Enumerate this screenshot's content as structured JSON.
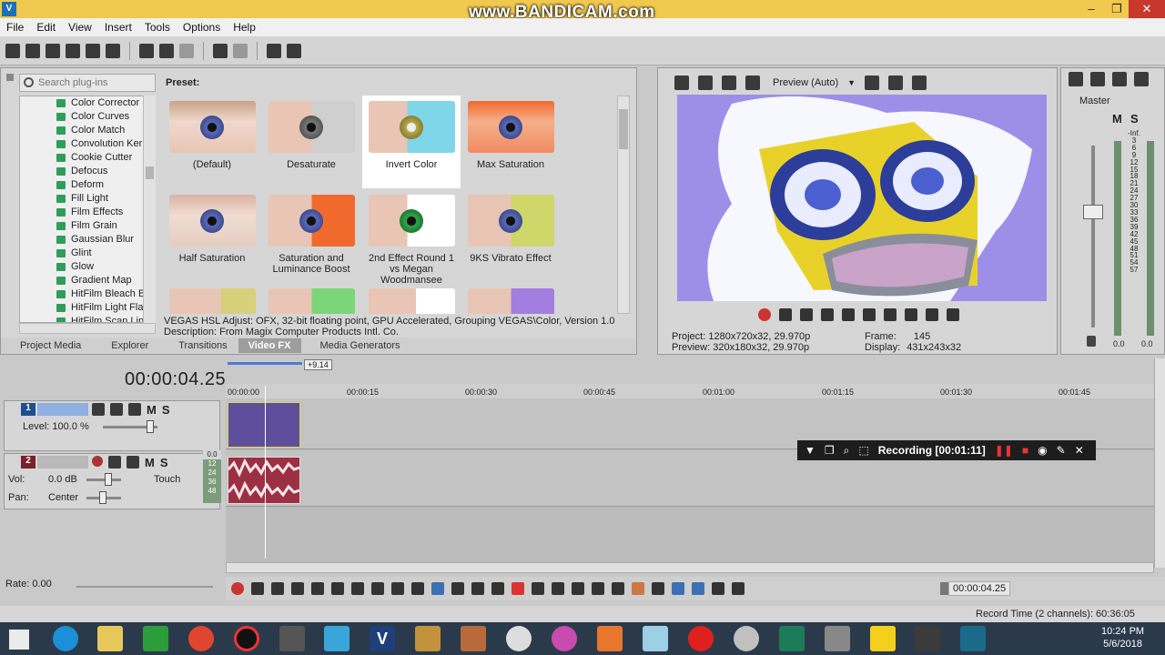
{
  "titlebar": {
    "watermark": "www.BANDICAM.com",
    "minimize": "–",
    "maximize": "❐",
    "close": "✕"
  },
  "menu": [
    "File",
    "Edit",
    "View",
    "Insert",
    "Tools",
    "Options",
    "Help"
  ],
  "plugins": {
    "search_placeholder": "Search plug-ins",
    "items": [
      "Color Corrector (S",
      "Color Curves",
      "Color Match",
      "Convolution Kern",
      "Cookie Cutter",
      "Defocus",
      "Deform",
      "Fill Light",
      "Film Effects",
      "Film Grain",
      "Gaussian Blur",
      "Glint",
      "Glow",
      "Gradient Map",
      "HitFilm Bleach Byp",
      "HitFilm Light Flare",
      "HitFilm Scan Lines"
    ],
    "preset_label": "Preset:",
    "presets": [
      {
        "name": "(Default)"
      },
      {
        "name": "Desaturate"
      },
      {
        "name": "Invert Color"
      },
      {
        "name": "Max Saturation"
      },
      {
        "name": "Half Saturation"
      },
      {
        "name": "Saturation and Luminance Boost"
      },
      {
        "name": "2nd Effect Round 1 vs Megan Woodmansee"
      },
      {
        "name": "9KS Vibrato Effect"
      }
    ],
    "desc_line1": "VEGAS HSL Adjust: OFX, 32-bit floating point, GPU Accelerated, Grouping VEGAS\\Color, Version 1.0",
    "desc_line2": "Description: From Magix Computer Products Intl. Co."
  },
  "dock_tabs": [
    "Project Media",
    "Explorer",
    "Transitions",
    "Video FX",
    "Media Generators"
  ],
  "preview": {
    "mode": "Preview (Auto)",
    "project_label": "Project:",
    "project_value": "1280x720x32, 29.970p",
    "preview_label": "Preview:",
    "preview_value": "320x180x32, 29.970p",
    "frame_label": "Frame:",
    "frame_value": "145",
    "display_label": "Display:",
    "display_value": "431x243x32"
  },
  "master": {
    "title": "Master",
    "m": "M",
    "s": "S",
    "scale": [
      "-Inf.",
      "-Inf.",
      "3",
      "6",
      "9",
      "12",
      "15",
      "18",
      "21",
      "24",
      "27",
      "30",
      "33",
      "36",
      "39",
      "42",
      "45",
      "48",
      "51",
      "54",
      "57"
    ],
    "left_level": "0.0",
    "right_level": "0.0"
  },
  "timeline": {
    "time": "00:00:04.25",
    "cursor_offset": "+9.14",
    "ticks": [
      "00:00:00",
      "00:00:15",
      "00:00:30",
      "00:00:45",
      "00:01:00",
      "00:01:15",
      "00:01:30",
      "00:01:45"
    ],
    "track1": {
      "num": "1",
      "level": "Level: 100.0 %",
      "m": "M",
      "s": "S"
    },
    "track2": {
      "num": "2",
      "vol_label": "Vol:",
      "vol_value": "0.0 dB",
      "pan_label": "Pan:",
      "pan_value": "Center",
      "touch": "Touch",
      "m": "M",
      "s": "S",
      "meter": [
        "0.0",
        "12",
        "24",
        "36",
        "48"
      ]
    },
    "rate": "Rate: 0.00",
    "transport_time": "00:00:04.25",
    "record_time": "Record Time (2 channels): 60:36:05"
  },
  "recording": {
    "label": "Recording [00:01:11]"
  },
  "taskbar": {
    "time": "10:24 PM",
    "date": "5/6/2018"
  },
  "colors": {
    "titlebar": "#f1c94e",
    "panel": "#d6d6d6",
    "timeline": "#c9c9c9",
    "video_clip": "#5f4e9c",
    "audio_clip": "#9c3042"
  }
}
